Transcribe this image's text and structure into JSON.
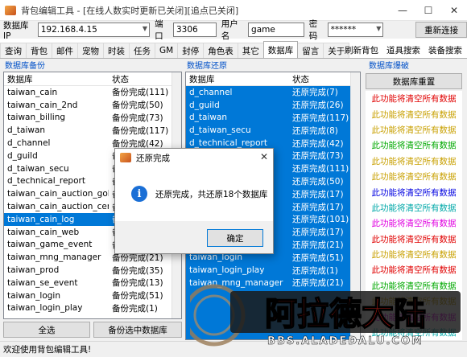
{
  "window": {
    "title": "背包编辑工具 - [在线人数实时更新已关闭][追点已关闭]",
    "minimize": "—",
    "maximize": "☐",
    "close": "✕"
  },
  "connection": {
    "ip_label": "数据库IP",
    "ip_value": "192.168.4.15",
    "port_label": "端口",
    "port_value": "3306",
    "user_label": "用户名",
    "user_value": "game",
    "pwd_label": "密码",
    "pwd_value": "******",
    "reconnect": "重新连接"
  },
  "tabs": [
    "查询",
    "背包",
    "邮件",
    "宠物",
    "时装",
    "任务",
    "GM",
    "封停",
    "角色表",
    "其它",
    "数据库",
    "留言",
    "关于"
  ],
  "selected_tab": "数据库",
  "tools": [
    "刷新背包",
    "道具搜索",
    "装备搜索"
  ],
  "backup": {
    "title": "数据库备份",
    "col1": "数据库",
    "col2": "状态",
    "rows": [
      [
        "taiwan_cain",
        "备份完成(111)"
      ],
      [
        "taiwan_cain_2nd",
        "备份完成(50)"
      ],
      [
        "taiwan_billing",
        "备份完成(73)"
      ],
      [
        "d_taiwan",
        "备份完成(117)"
      ],
      [
        "d_channel",
        "备份完成(42)"
      ],
      [
        "d_guild",
        "备份完成(26)"
      ],
      [
        "d_taiwan_secu",
        "备份完成(8)"
      ],
      [
        "d_technical_report",
        "备份完成(1)"
      ],
      [
        "taiwan_cain_auction_gold",
        "备份完成(17)"
      ],
      [
        "taiwan_cain_auction_cera",
        "备份完成(17)"
      ],
      [
        "taiwan_cain_log",
        "备份完成(101)"
      ],
      [
        "taiwan_cain_web",
        "备份完成(17)"
      ],
      [
        "taiwan_game_event",
        "备份完成(17)"
      ],
      [
        "taiwan_mng_manager",
        "备份完成(21)"
      ],
      [
        "taiwan_prod",
        "备份完成(35)"
      ],
      [
        "taiwan_se_event",
        "备份完成(13)"
      ],
      [
        "taiwan_login",
        "备份完成(51)"
      ],
      [
        "taiwan_login_play",
        "备份完成(1)"
      ]
    ],
    "selected_row": 10,
    "select_all": "全选",
    "backup_selected": "备份选中数据库"
  },
  "restore": {
    "title": "数据库还原",
    "col1": "数据库",
    "col2": "状态",
    "rows": [
      [
        "d_channel",
        "还原完成(7)"
      ],
      [
        "d_guild",
        "还原完成(26)"
      ],
      [
        "d_taiwan",
        "还原完成(117)"
      ],
      [
        "d_taiwan_secu",
        "还原完成(8)"
      ],
      [
        "d_technical_report",
        "还原完成(42)"
      ],
      [
        "",
        "还原完成(73)"
      ],
      [
        "",
        "还原完成(111)"
      ],
      [
        "",
        "还原完成(50)"
      ],
      [
        "",
        "还原完成(17)"
      ],
      [
        "",
        "还原完成(17)"
      ],
      [
        "",
        "还原完成(101)"
      ],
      [
        "",
        "还原完成(17)"
      ],
      [
        "",
        "还原完成(21)"
      ],
      [
        "taiwan_login",
        "还原完成(51)"
      ],
      [
        "taiwan_login_play",
        "还原完成(1)"
      ],
      [
        "taiwan_mng_manager",
        "还原完成(21)"
      ]
    ]
  },
  "reset": {
    "title": "数据库爆破",
    "button": "数据库重置",
    "warning": "此功能将清空所有数据",
    "colors": [
      "#e00000",
      "#c8a000",
      "#c8a000",
      "#00a800",
      "#c8a000",
      "#c8a000",
      "#0000e0",
      "#00a8a8",
      "#e000e0",
      "#e00000",
      "#c8a000",
      "#e00000",
      "#00a800",
      "#c8a000",
      "#e000e0",
      "#00a8a8"
    ]
  },
  "dialog": {
    "title": "还原完成",
    "message": "还原完成，共还原18个数据库",
    "ok": "确定"
  },
  "status": "欢迎使用背包编辑工具!",
  "watermark": {
    "logo": "阿拉德大陆",
    "url": "BBS.ALADEDALU.COM"
  }
}
